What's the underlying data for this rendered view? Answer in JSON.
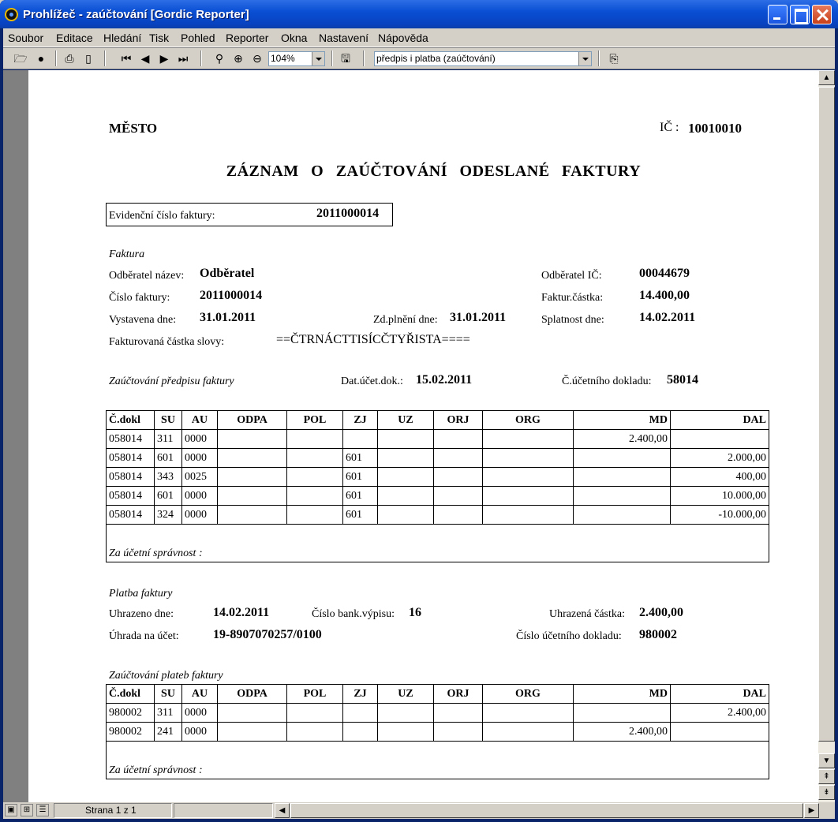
{
  "window": {
    "title": "Prohlížeč - zaúčtování [Gordic Reporter]"
  },
  "menu": [
    "Soubor",
    "Editace",
    "Hledání",
    "Tisk",
    "Pohled",
    "Reporter",
    "Okna",
    "Nastavení",
    "Nápověda"
  ],
  "toolbar": {
    "zoom": "104%",
    "report": "předpis i platba (zaúčtování)"
  },
  "status": {
    "page": "Strana 1 z 1"
  },
  "doc": {
    "org": "MĚSTO",
    "ic_label": "IČ :",
    "ic": "10010010",
    "title": "ZÁZNAM O ZAÚČTOVÁNÍ ODESLANÉ FAKTURY",
    "evid_label": "Evidenční číslo faktury:",
    "evid": "2011000014",
    "inv_section": "Faktura",
    "cust_name_label": "Odběratel název:",
    "cust_name": "Odběratel",
    "cust_ic_label": "Odběratel IČ:",
    "cust_ic": "00044679",
    "inv_no_label": "Číslo faktury:",
    "inv_no": "2011000014",
    "inv_amt_label": "Faktur.částka:",
    "inv_amt": "14.400,00",
    "issued_label": "Vystavena dne:",
    "issued": "31.01.2011",
    "taxdate_label": "Zd.plnění dne:",
    "taxdate": "31.01.2011",
    "due_label": "Splatnost dne:",
    "due": "14.02.2011",
    "words_label": "Fakturovaná částka slovy:",
    "words": "==ČTRNÁCTTISÍCČTYŘISTA====",
    "posting_label": "Zaúčtování předpisu faktury",
    "acct_date_label": "Dat.účet.dok.:",
    "acct_date": "15.02.2011",
    "acct_doc_label": "Č.účetního dokladu:",
    "acct_doc": "58014",
    "columns": [
      "Č.dokl",
      "SU",
      "AU",
      "ODPA",
      "POL",
      "ZJ",
      "UZ",
      "ORJ",
      "ORG",
      "MD",
      "DAL"
    ],
    "rows1": [
      [
        "058014",
        "311",
        "0000",
        "",
        "",
        "",
        "",
        "",
        "",
        "2.400,00",
        ""
      ],
      [
        "058014",
        "601",
        "0000",
        "",
        "",
        "601",
        "",
        "",
        "",
        "",
        "2.000,00"
      ],
      [
        "058014",
        "343",
        "0025",
        "",
        "",
        "601",
        "",
        "",
        "",
        "",
        "400,00"
      ],
      [
        "058014",
        "601",
        "0000",
        "",
        "",
        "601",
        "",
        "",
        "",
        "",
        "10.000,00"
      ],
      [
        "058014",
        "324",
        "0000",
        "",
        "",
        "601",
        "",
        "",
        "",
        "",
        "-10.000,00"
      ]
    ],
    "correctness": "Za účetní správnost  :",
    "pay_section": "Platba faktury",
    "paid_label": "Uhrazeno dne:",
    "paid": "14.02.2011",
    "stmt_label": "Číslo bank.výpisu:",
    "stmt": "16",
    "paid_amt_label": "Uhrazená částka:",
    "paid_amt": "2.400,00",
    "acct_label": "Úhrada na účet:",
    "acct": "19-8907070257/0100",
    "pay_doc_label": "Číslo účetního dokladu:",
    "pay_doc": "980002",
    "pay_posting_label": "Zaúčtování plateb faktury",
    "rows2": [
      [
        "980002",
        "311",
        "0000",
        "",
        "",
        "",
        "",
        "",
        "",
        "",
        "2.400,00"
      ],
      [
        "980002",
        "241",
        "0000",
        "",
        "",
        "",
        "",
        "",
        "",
        "2.400,00",
        ""
      ]
    ]
  }
}
